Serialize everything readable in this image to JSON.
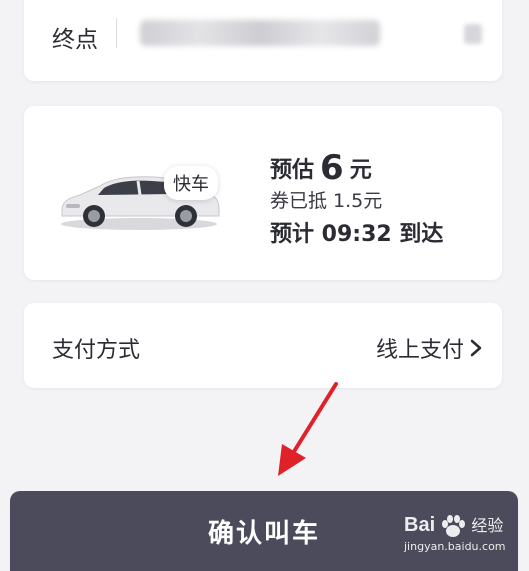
{
  "destination": {
    "label": "终点"
  },
  "ride": {
    "car_type": "快车",
    "price_prefix": "预估",
    "price_value": "6",
    "price_unit": "元",
    "coupon": "券已抵 1.5元",
    "eta": "预计 09:32 到达"
  },
  "payment": {
    "label": "支付方式",
    "method": "线上支付"
  },
  "confirm": {
    "label": "确认叫车"
  },
  "watermark": {
    "brand_a": "Bai",
    "brand_b": "经验",
    "url": "jingyan.baidu.com"
  },
  "colors": {
    "background": "#f3f3f5",
    "card": "#ffffff",
    "button": "#4b4b5c",
    "arrow": "#e0212a",
    "text": "#2b2b33"
  },
  "icons": [
    "car-icon",
    "chevron-right-icon",
    "red-arrow-annotation-icon",
    "baidu-paw-icon"
  ]
}
